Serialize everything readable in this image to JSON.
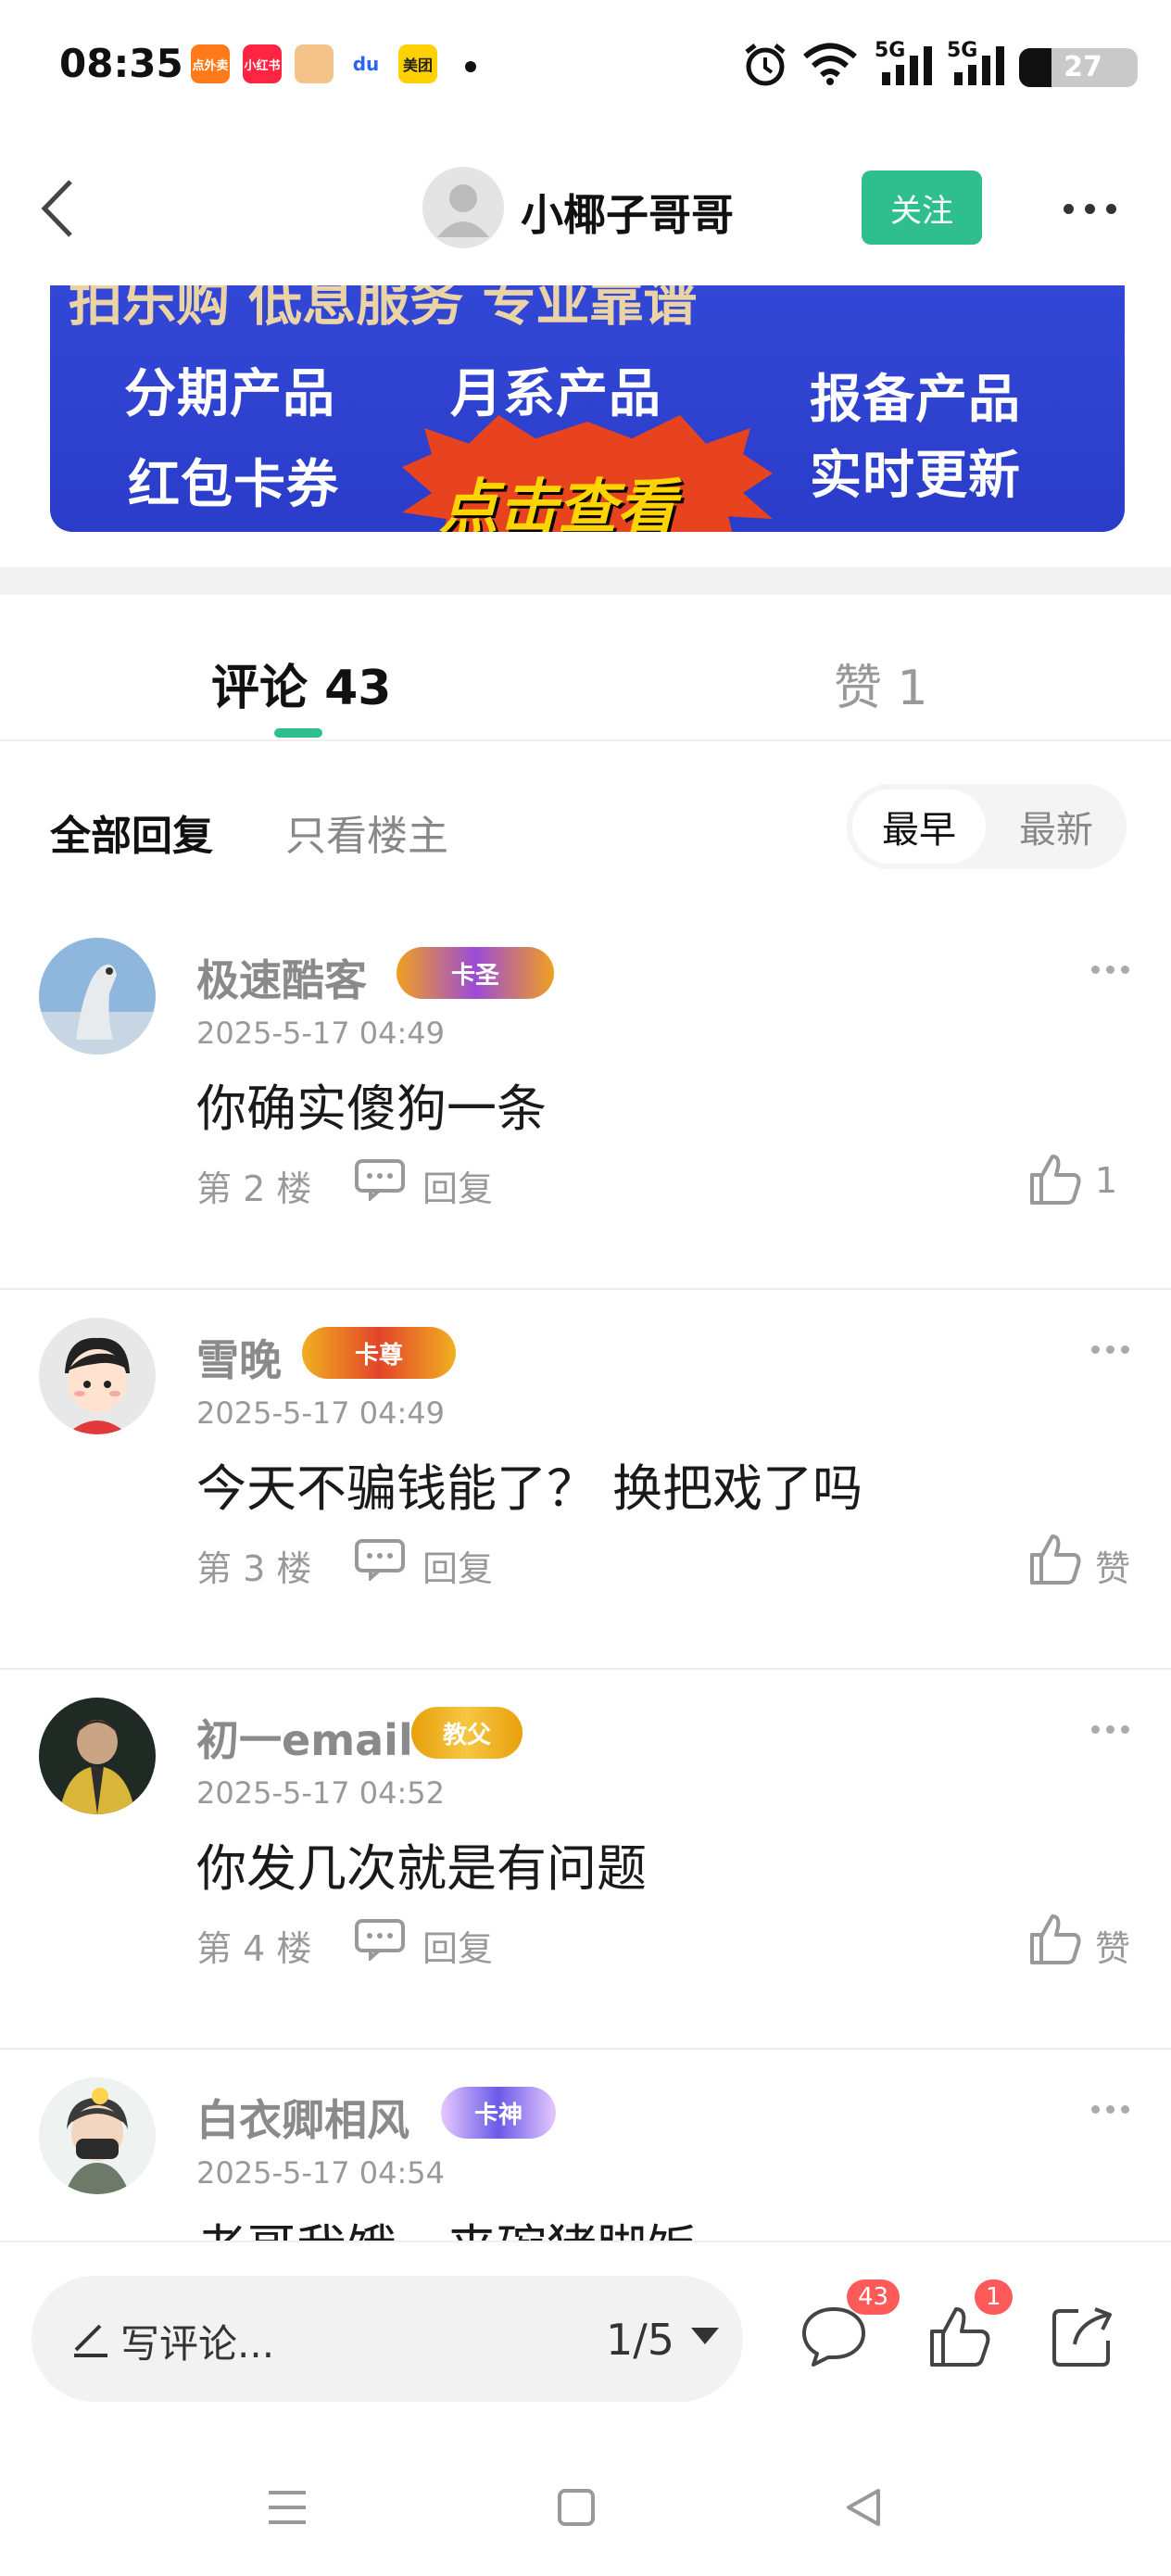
{
  "status_bar": {
    "time": "08:35",
    "apps": [
      "点外卖",
      "小红书",
      "",
      "du",
      "美团"
    ],
    "network_1": "5G",
    "network_2": "5G",
    "battery": "27",
    "battery_level": 0.27
  },
  "header": {
    "username": "小椰子哥哥",
    "follow_label": "关注"
  },
  "banner": {
    "top_text": "拍乐购   低息服务 专业靠谱",
    "items": [
      "分期产品",
      "月系产品",
      "报备产品",
      "红包卡券",
      "实时更新"
    ],
    "cta": "点击查看"
  },
  "tabs": {
    "comment_label": "评论 43",
    "like_label": "赞 1"
  },
  "filters": {
    "all_label": "全部回复",
    "op_label": "只看楼主",
    "sort_earliest": "最早",
    "sort_newest": "最新"
  },
  "comments": [
    {
      "name": "极速酷客",
      "badge": "卡圣",
      "time": "2025-5-17 04:49",
      "text": "你确实傻狗一条",
      "floor": "第 2 楼",
      "reply": "回复",
      "likes": "1"
    },
    {
      "name": "雪晚",
      "badge": "卡尊",
      "time": "2025-5-17 04:49",
      "text": "今天不骗钱能了？ 换把戏了吗",
      "floor": "第 3 楼",
      "reply": "回复",
      "likes": "赞"
    },
    {
      "name": "初一email",
      "badge": "教父",
      "time": "2025-5-17 04:52",
      "text": "你发几次就是有问题",
      "floor": "第 4 楼",
      "reply": "回复",
      "likes": "赞"
    },
    {
      "name": "白衣卿相风",
      "badge": "卡神",
      "time": "2025-5-17 04:54",
      "text": "老哥我饿，来碗猪脚饭",
      "floor": "",
      "reply": "",
      "likes": ""
    }
  ],
  "bottom_bar": {
    "write_placeholder": "写评论...",
    "page_indicator": "1/5",
    "comment_badge": "43",
    "like_badge": "1"
  },
  "colors": {
    "accent": "#2fbf8f",
    "banner_blue": "#2f42cf",
    "badge_red": "#ff5a5a"
  }
}
